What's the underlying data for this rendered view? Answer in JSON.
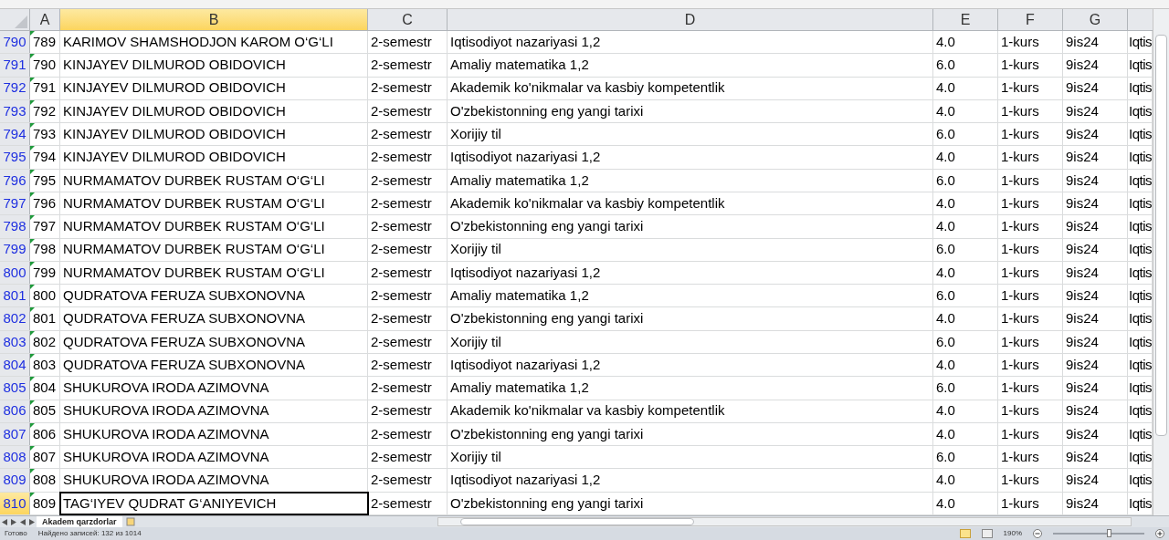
{
  "columns": [
    {
      "label": "A",
      "selected": false
    },
    {
      "label": "B",
      "selected": true
    },
    {
      "label": "C",
      "selected": false
    },
    {
      "label": "D",
      "selected": false
    },
    {
      "label": "E",
      "selected": false
    },
    {
      "label": "F",
      "selected": false
    },
    {
      "label": "G",
      "selected": false
    }
  ],
  "rows": [
    {
      "header": "790",
      "selected": false,
      "flagged": true,
      "cells": [
        "789",
        "KARIMOV SHAMSHODJON KAROM O‘G‘LI",
        "2-semestr",
        "Iqtisodiyot nazariyasi 1,2",
        "4.0",
        "1-kurs",
        "9is24",
        "Iqtis"
      ]
    },
    {
      "header": "791",
      "selected": false,
      "flagged": true,
      "cells": [
        "790",
        "KINJAYEV DILMUROD OBIDOVICH",
        "2-semestr",
        "Amaliy matematika 1,2",
        "6.0",
        "1-kurs",
        "9is24",
        "Iqtis"
      ]
    },
    {
      "header": "792",
      "selected": false,
      "flagged": true,
      "cells": [
        "791",
        "KINJAYEV DILMUROD OBIDOVICH",
        "2-semestr",
        "Akademik ko'nikmalar va kasbiy kompetentlik",
        "4.0",
        "1-kurs",
        "9is24",
        "Iqtis"
      ]
    },
    {
      "header": "793",
      "selected": false,
      "flagged": true,
      "cells": [
        "792",
        "KINJAYEV DILMUROD OBIDOVICH",
        "2-semestr",
        "O'zbekistonning eng yangi tarixi",
        "4.0",
        "1-kurs",
        "9is24",
        "Iqtis"
      ]
    },
    {
      "header": "794",
      "selected": false,
      "flagged": true,
      "cells": [
        "793",
        "KINJAYEV DILMUROD OBIDOVICH",
        "2-semestr",
        "Xorijiy til",
        "6.0",
        "1-kurs",
        "9is24",
        "Iqtis"
      ]
    },
    {
      "header": "795",
      "selected": false,
      "flagged": true,
      "cells": [
        "794",
        "KINJAYEV DILMUROD OBIDOVICH",
        "2-semestr",
        "Iqtisodiyot nazariyasi 1,2",
        "4.0",
        "1-kurs",
        "9is24",
        "Iqtis"
      ]
    },
    {
      "header": "796",
      "selected": false,
      "flagged": true,
      "cells": [
        "795",
        "NURMAMATOV DURBEK RUSTAM O‘G‘LI",
        "2-semestr",
        "Amaliy matematika 1,2",
        "6.0",
        "1-kurs",
        "9is24",
        "Iqtis"
      ]
    },
    {
      "header": "797",
      "selected": false,
      "flagged": true,
      "cells": [
        "796",
        "NURMAMATOV DURBEK RUSTAM O‘G‘LI",
        "2-semestr",
        "Akademik ko'nikmalar va kasbiy kompetentlik",
        "4.0",
        "1-kurs",
        "9is24",
        "Iqtis"
      ]
    },
    {
      "header": "798",
      "selected": false,
      "flagged": true,
      "cells": [
        "797",
        "NURMAMATOV DURBEK RUSTAM O‘G‘LI",
        "2-semestr",
        "O'zbekistonning eng yangi tarixi",
        "4.0",
        "1-kurs",
        "9is24",
        "Iqtis"
      ]
    },
    {
      "header": "799",
      "selected": false,
      "flagged": true,
      "cells": [
        "798",
        "NURMAMATOV DURBEK RUSTAM O‘G‘LI",
        "2-semestr",
        "Xorijiy til",
        "6.0",
        "1-kurs",
        "9is24",
        "Iqtis"
      ]
    },
    {
      "header": "800",
      "selected": false,
      "flagged": true,
      "cells": [
        "799",
        "NURMAMATOV DURBEK RUSTAM O‘G‘LI",
        "2-semestr",
        "Iqtisodiyot nazariyasi 1,2",
        "4.0",
        "1-kurs",
        "9is24",
        "Iqtis"
      ]
    },
    {
      "header": "801",
      "selected": false,
      "flagged": true,
      "cells": [
        "800",
        "QUDRATOVA FERUZA SUBXONOVNA",
        "2-semestr",
        "Amaliy matematika 1,2",
        "6.0",
        "1-kurs",
        "9is24",
        "Iqtis"
      ]
    },
    {
      "header": "802",
      "selected": false,
      "flagged": true,
      "cells": [
        "801",
        "QUDRATOVA FERUZA SUBXONOVNA",
        "2-semestr",
        "O'zbekistonning eng yangi tarixi",
        "4.0",
        "1-kurs",
        "9is24",
        "Iqtis"
      ]
    },
    {
      "header": "803",
      "selected": false,
      "flagged": true,
      "cells": [
        "802",
        "QUDRATOVA FERUZA SUBXONOVNA",
        "2-semestr",
        "Xorijiy til",
        "6.0",
        "1-kurs",
        "9is24",
        "Iqtis"
      ]
    },
    {
      "header": "804",
      "selected": false,
      "flagged": true,
      "cells": [
        "803",
        "QUDRATOVA FERUZA SUBXONOVNA",
        "2-semestr",
        "Iqtisodiyot nazariyasi 1,2",
        "4.0",
        "1-kurs",
        "9is24",
        "Iqtis"
      ]
    },
    {
      "header": "805",
      "selected": false,
      "flagged": true,
      "cells": [
        "804",
        "SHUKUROVA IRODA AZIMOVNA",
        "2-semestr",
        "Amaliy matematika 1,2",
        "6.0",
        "1-kurs",
        "9is24",
        "Iqtis"
      ]
    },
    {
      "header": "806",
      "selected": false,
      "flagged": true,
      "cells": [
        "805",
        "SHUKUROVA IRODA AZIMOVNA",
        "2-semestr",
        "Akademik ko'nikmalar va kasbiy kompetentlik",
        "4.0",
        "1-kurs",
        "9is24",
        "Iqtis"
      ]
    },
    {
      "header": "807",
      "selected": false,
      "flagged": true,
      "cells": [
        "806",
        "SHUKUROVA IRODA AZIMOVNA",
        "2-semestr",
        "O'zbekistonning eng yangi tarixi",
        "4.0",
        "1-kurs",
        "9is24",
        "Iqtis"
      ]
    },
    {
      "header": "808",
      "selected": false,
      "flagged": true,
      "cells": [
        "807",
        "SHUKUROVA IRODA AZIMOVNA",
        "2-semestr",
        "Xorijiy til",
        "6.0",
        "1-kurs",
        "9is24",
        "Iqtis"
      ]
    },
    {
      "header": "809",
      "selected": false,
      "flagged": true,
      "cells": [
        "808",
        "SHUKUROVA IRODA AZIMOVNA",
        "2-semestr",
        "Iqtisodiyot nazariyasi 1,2",
        "4.0",
        "1-kurs",
        "9is24",
        "Iqtis"
      ]
    },
    {
      "header": "810",
      "selected": true,
      "flagged": true,
      "cells": [
        "809",
        "TAG‘IYEV QUDRAT G‘ANIYEVICH",
        "2-semestr",
        "O'zbekistonning eng yangi tarixi",
        "4.0",
        "1-kurs",
        "9is24",
        "Iqtis"
      ]
    }
  ],
  "sheet_tabs": [
    {
      "label": "Akadem qarzdorlar",
      "selected": true
    }
  ],
  "status_bar": {
    "status": "Готово",
    "records": "Найдено записей: 132 из 1014",
    "zoom": "190%",
    "zoom_slider": {
      "level": 0.62
    }
  }
}
